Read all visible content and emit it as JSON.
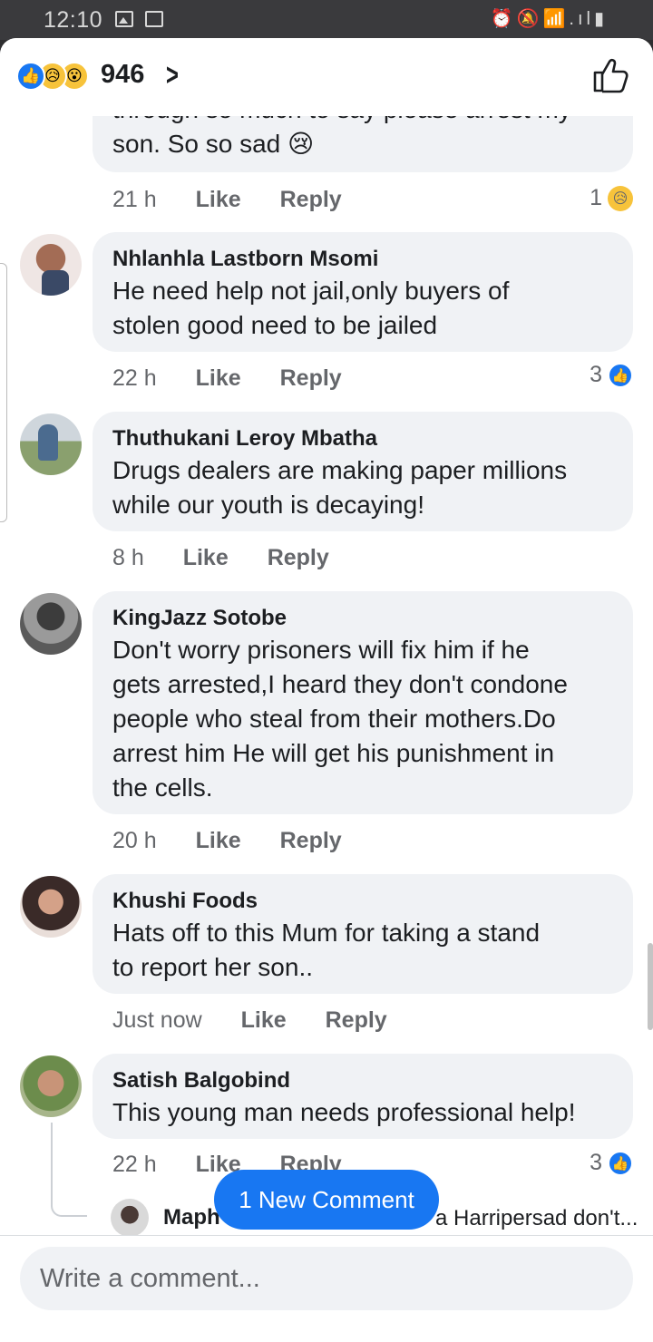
{
  "status_bar": {
    "time": "12:10",
    "right_icons": "⏰🔕📶.ıl▮",
    "icon_names": [
      "gallery-icon",
      "screen-icon",
      "alarm-icon",
      "mute-icon",
      "wifi-icon",
      "signal-icon",
      "battery-icon"
    ]
  },
  "header": {
    "reaction_count": "946",
    "reaction_icons": [
      "like",
      "sad",
      "wow"
    ]
  },
  "comments": [
    {
      "text": "through so much to say please arrest my\nson. So so sad 😢",
      "time": "21 h",
      "like": "Like",
      "reply": "Reply",
      "reaction_count": "1",
      "reaction": "sad"
    },
    {
      "author": "Nhlanhla Lastborn Msomi",
      "text": "He need help not jail,only  buyers of\nstolen good need to be jailed",
      "time": "22 h",
      "like": "Like",
      "reply": "Reply",
      "reaction_count": "3",
      "reaction": "like"
    },
    {
      "author": "Thuthukani Leroy Mbatha",
      "text": "Drugs dealers are making  paper millions\nwhile our youth is decaying!",
      "time": "8 h",
      "like": "Like",
      "reply": "Reply"
    },
    {
      "author": "KingJazz Sotobe",
      "text": "Don't worry prisoners will fix him if he\ngets arrested,I heard they don't condone\npeople who steal from their mothers.Do\narrest him He will get his punishment in\nthe cells.",
      "time": "20 h",
      "like": "Like",
      "reply": "Reply"
    },
    {
      "author": "Khushi Foods",
      "text": "Hats off to this Mum for taking a stand\nto report her son..",
      "time": "Just now",
      "like": "Like",
      "reply": "Reply"
    },
    {
      "author": "Satish Balgobind",
      "text": "This young man needs professional help!",
      "time": "22 h",
      "like": "Like",
      "reply": "Reply",
      "reaction_count": "3",
      "reaction": "like"
    }
  ],
  "reply_preview": {
    "author": "Maph",
    "text": "a Harripersad don't..."
  },
  "new_comment_pill": "1 New Comment",
  "composer": {
    "placeholder": "Write a comment..."
  },
  "colors": {
    "accent": "#1877f2",
    "bubble": "#f0f2f5",
    "meta": "#65676b",
    "text": "#1c1e21"
  }
}
